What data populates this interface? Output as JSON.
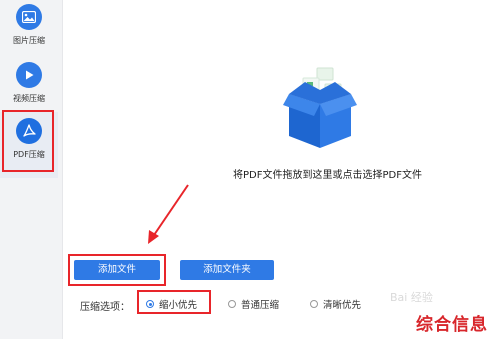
{
  "sidebar": {
    "items": [
      {
        "label": "图片压缩",
        "icon": "image-icon"
      },
      {
        "label": "视频压缩",
        "icon": "play-icon"
      },
      {
        "label": "PDF压缩",
        "icon": "pdf-acrobat-icon",
        "active": true
      }
    ]
  },
  "drop_zone": {
    "icon": "open-box-icon",
    "text": "将PDF文件拖放到这里或点击选择PDF文件"
  },
  "actions": {
    "add_file": "添加文件",
    "add_folder": "添加文件夹"
  },
  "compress": {
    "label": "压缩选项：",
    "options": [
      {
        "label": "缩小优先",
        "selected": true
      },
      {
        "label": "普通压缩",
        "selected": false
      },
      {
        "label": "清晰优先",
        "selected": false
      }
    ]
  },
  "watermark": {
    "text": "综合信息",
    "logo": "Bai 经验"
  },
  "colors": {
    "accent": "#2f7ae5",
    "annotation_red": "#e8252a"
  }
}
